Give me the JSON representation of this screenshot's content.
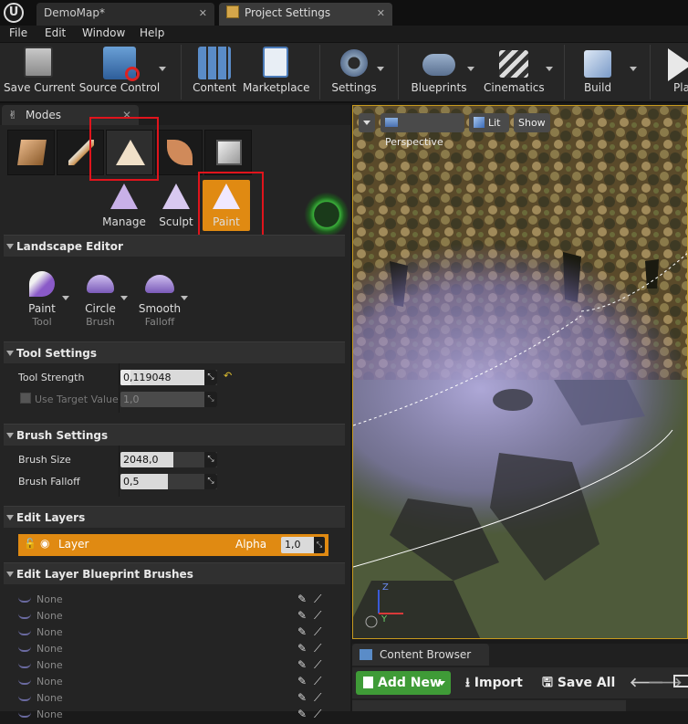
{
  "tabs": [
    {
      "label": "DemoMap*"
    },
    {
      "label": "Project Settings"
    }
  ],
  "menu": [
    "File",
    "Edit",
    "Window",
    "Help"
  ],
  "toolbar": {
    "save_current": "Save Current",
    "source_control": "Source Control",
    "content": "Content",
    "marketplace": "Marketplace",
    "settings": "Settings",
    "blueprints": "Blueprints",
    "cinematics": "Cinematics",
    "build": "Build",
    "play": "Pla"
  },
  "modes": {
    "title": "Modes",
    "sub_modes": {
      "manage": "Manage",
      "sculpt": "Sculpt",
      "paint": "Paint"
    }
  },
  "landscape_editor": {
    "title": "Landscape Editor",
    "tool": {
      "name": "Paint",
      "caption": "Tool"
    },
    "brush": {
      "name": "Circle",
      "caption": "Brush"
    },
    "falloff": {
      "name": "Smooth",
      "caption": "Falloff"
    }
  },
  "tool_settings": {
    "title": "Tool Settings",
    "tool_strength_label": "Tool Strength",
    "tool_strength_value": "0,119048",
    "tool_strength_fraction": 0.119,
    "use_target_label": "Use Target Value",
    "use_target_value": "1,0"
  },
  "brush_settings": {
    "title": "Brush Settings",
    "size_label": "Brush Size",
    "size_value": "2048,0",
    "falloff_label": "Brush Falloff",
    "falloff_value": "0,5"
  },
  "edit_layers": {
    "title": "Edit Layers",
    "layer_name": "Layer",
    "alpha_label": "Alpha",
    "alpha_value": "1,0"
  },
  "blueprint_brushes": {
    "title": "Edit Layer Blueprint Brushes",
    "items": [
      "None",
      "None",
      "None",
      "None",
      "None",
      "None",
      "None",
      "None"
    ]
  },
  "viewport": {
    "perspective": "Perspective",
    "lit": "Lit",
    "show": "Show",
    "axis_z": "Z",
    "axis_y": "Y"
  },
  "content_browser": {
    "title": "Content Browser",
    "add_new": "Add New",
    "import": "Import",
    "save_all": "Save All"
  },
  "colors": {
    "accent_orange": "#e08a12",
    "highlight_red": "#e0141c",
    "add_green": "#3f9b37",
    "viewport_border": "#c79a1e"
  }
}
